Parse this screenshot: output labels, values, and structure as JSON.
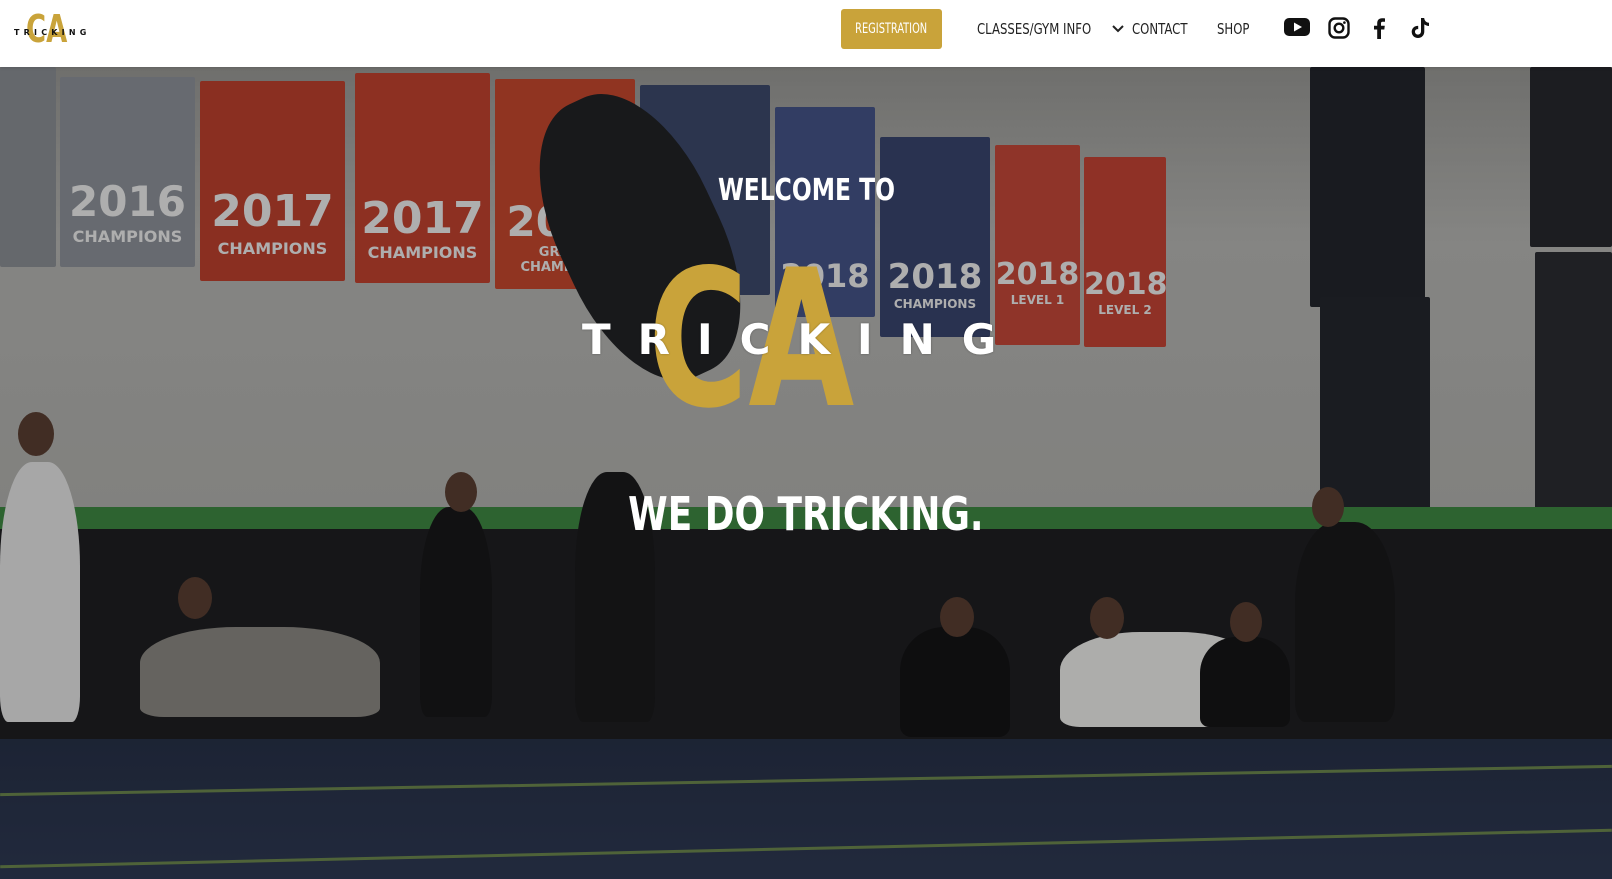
{
  "header": {
    "logo": {
      "mark": "CA",
      "word": "TRICKING"
    },
    "nav": {
      "register_label": "Registration",
      "classes_label": "Classes/Gym Info",
      "contact_label": "Contact",
      "shop_label": "Shop"
    },
    "social": [
      "youtube-icon",
      "instagram-icon",
      "facebook-icon",
      "tiktok-icon"
    ]
  },
  "hero": {
    "welcome": "Welcome to",
    "logo": {
      "mark": "CA",
      "word": "TRICKING"
    },
    "tagline": "We do tricking.",
    "banners": [
      {
        "year": "2016",
        "caption": "CHAMPIONS"
      },
      {
        "year": "2017",
        "caption": "CHAMPIONS"
      },
      {
        "year": "2017",
        "caption": "CHAMPIONS"
      },
      {
        "year": "2017",
        "caption": "GRAND CHAMPIONS"
      },
      {
        "year": "2018",
        "caption": "CHAMPIONS"
      },
      {
        "year": "2018",
        "caption": "CHAMPIONS"
      },
      {
        "year": "2018",
        "caption": "LEVEL 1"
      },
      {
        "year": "2018",
        "caption": "LEVEL 2"
      }
    ]
  },
  "colors": {
    "accent": "#c9a33a",
    "header_bg": "#ffffff",
    "nav_text": "#222222"
  }
}
